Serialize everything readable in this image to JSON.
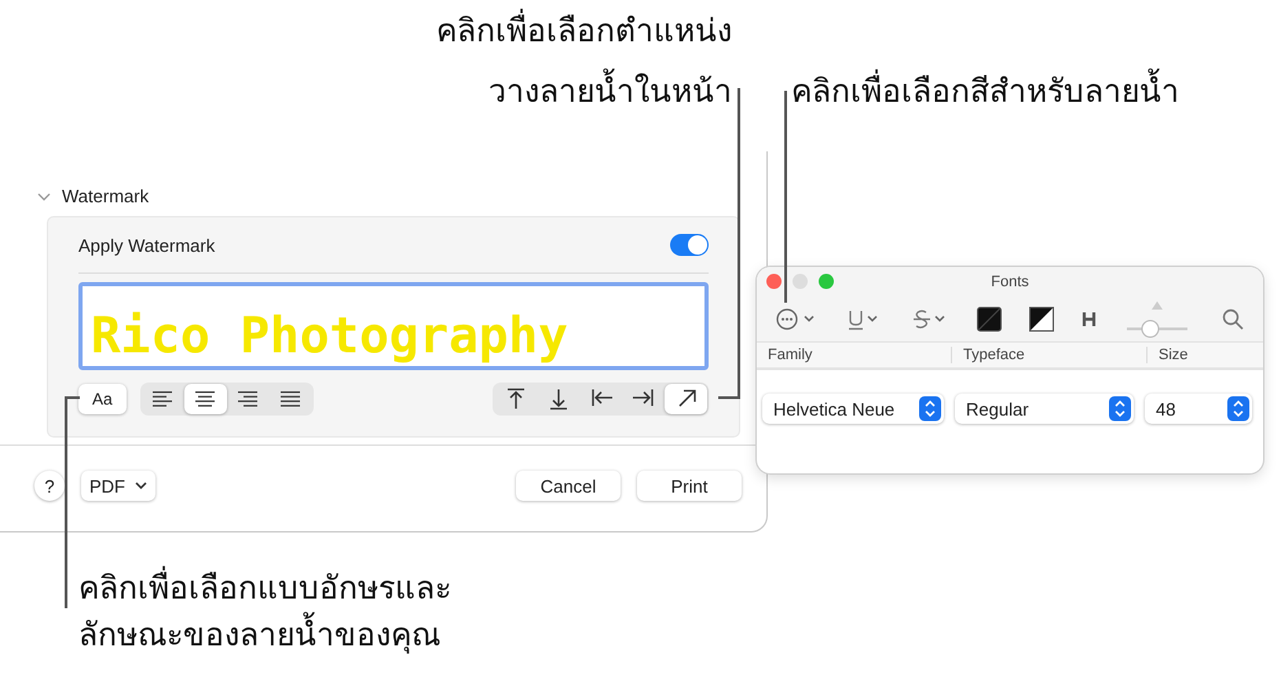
{
  "callouts": [
    {
      "kind": "position",
      "lines": [
        "คลิกเพื่อเลือกตำแหน่ง",
        "วางลายน้ำในหน้า"
      ]
    },
    {
      "kind": "color",
      "lines": [
        "คลิกเพื่อเลือกสีสำหรับลายน้ำ"
      ]
    },
    {
      "kind": "font",
      "lines": [
        "คลิกเพื่อเลือกแบบอักษรและ",
        "ลักษณะของลายน้ำของคุณ"
      ]
    }
  ],
  "print_dialog": {
    "section": {
      "title": "Watermark",
      "expanded": true
    },
    "apply": {
      "label": "Apply Watermark",
      "on": true
    },
    "watermark_text": {
      "value": "Rico Photography"
    },
    "font_button": "Aa",
    "alignment": [
      {
        "kind": "left",
        "selected": false
      },
      {
        "kind": "center",
        "selected": true
      },
      {
        "kind": "right",
        "selected": false
      },
      {
        "kind": "justify",
        "selected": false
      }
    ],
    "position": [
      {
        "kind": "top",
        "selected": false
      },
      {
        "kind": "bottom",
        "selected": false
      },
      {
        "kind": "left",
        "selected": false
      },
      {
        "kind": "right",
        "selected": false
      },
      {
        "kind": "diagonal",
        "selected": true
      }
    ],
    "help": "?",
    "pdf": "PDF",
    "buttons": [
      "Cancel",
      "Print"
    ]
  },
  "fonts_window": {
    "title": "Fonts",
    "columns": [
      "Family",
      "Typeface",
      "Size"
    ],
    "family": "Helvetica Neue",
    "typeface": "Regular",
    "size": "48"
  }
}
